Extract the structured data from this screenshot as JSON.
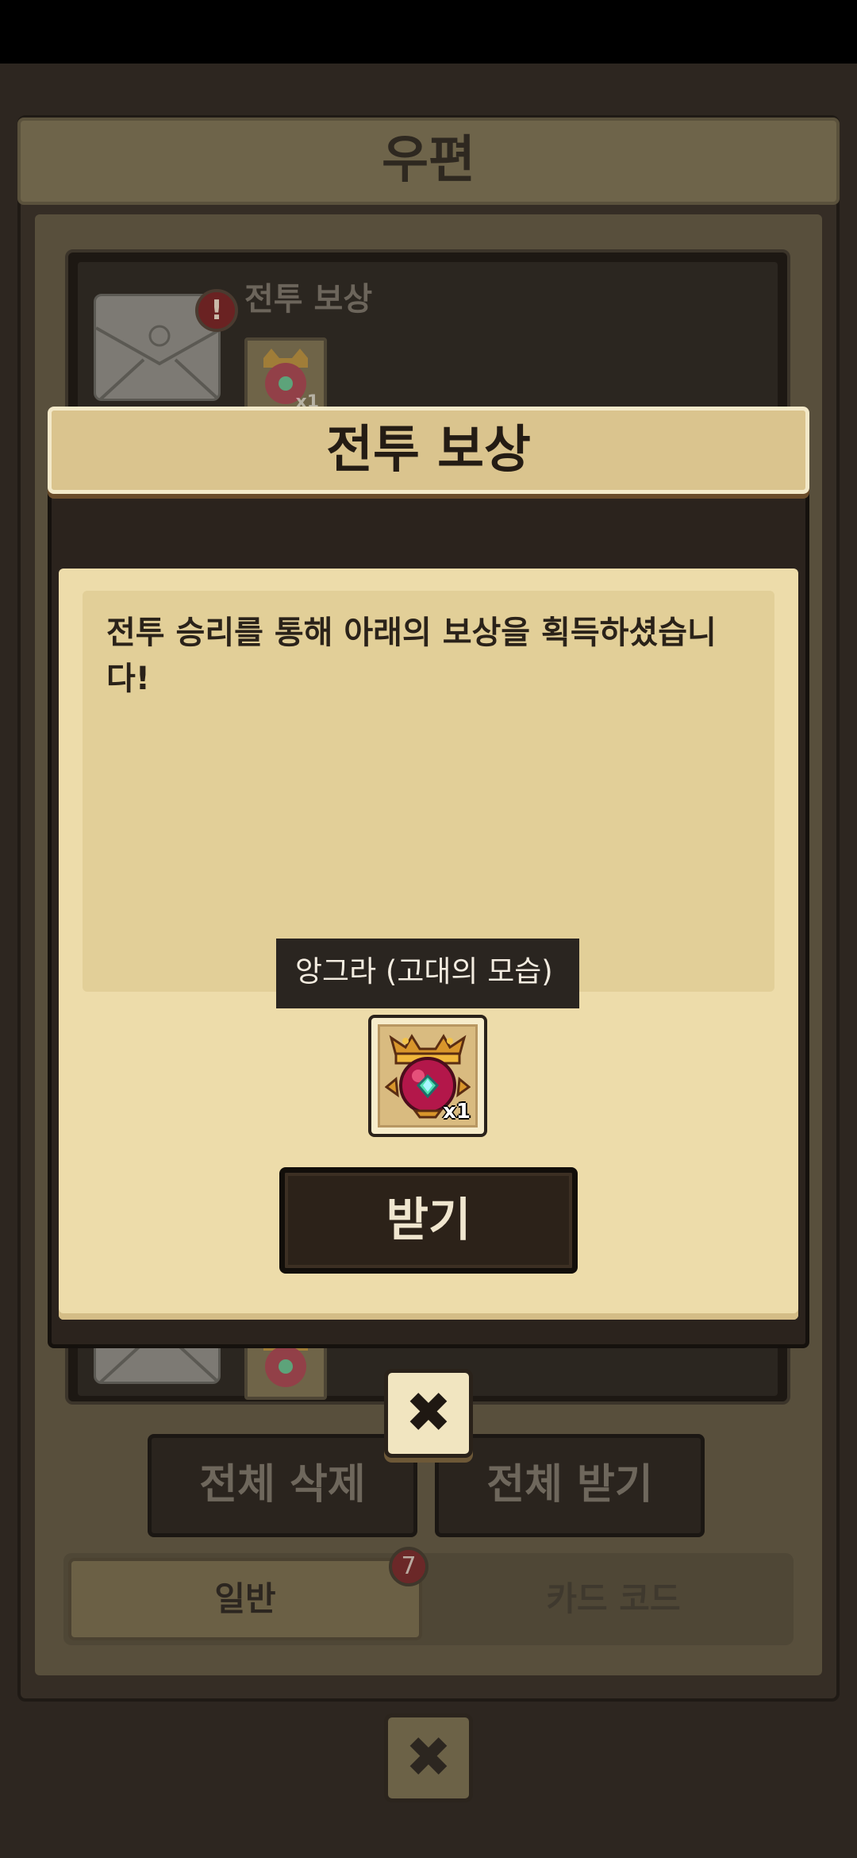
{
  "background_screen": {
    "title": "우편",
    "mails": [
      {
        "title": "전투 보상",
        "item_qty": "x1",
        "alert": "!"
      },
      {
        "title": "",
        "item_qty": "",
        "alert": ""
      }
    ],
    "delete_all_label": "전체 삭제",
    "receive_all_label": "전체 받기",
    "tabs": [
      {
        "label": "일반",
        "badge": "7",
        "active": true
      },
      {
        "label": "카드 코드",
        "active": false
      }
    ],
    "close_label": "✖"
  },
  "dialog": {
    "title": "전투 보상",
    "message": "전투 승리를 통해 아래의 보상을 획득하셨습니다!",
    "reward": {
      "name": "앙그라 (고대의 모습)",
      "qty": "x1",
      "icon": "crowned-red-orb-icon"
    },
    "claim_label": "받기",
    "close_label": "✖"
  }
}
